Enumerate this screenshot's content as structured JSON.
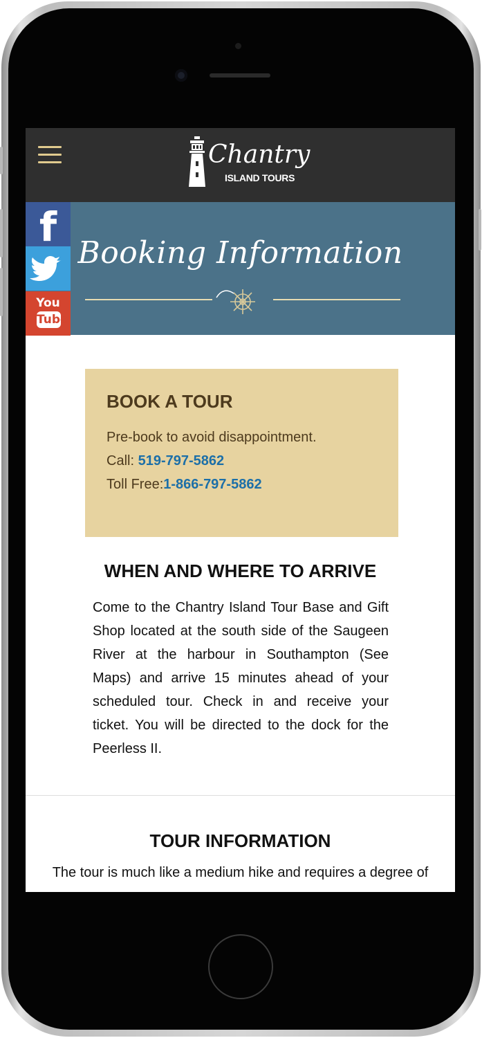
{
  "header": {
    "menu_icon": "hamburger-menu-icon",
    "logo": {
      "script_text": "Chantry",
      "sub_text": "ISLAND TOURS",
      "icon": "lighthouse-icon"
    }
  },
  "banner": {
    "title": "Booking Information",
    "icon": "ship-wheel-icon"
  },
  "social": {
    "facebook": {
      "glyph": "f",
      "icon": "facebook-icon"
    },
    "twitter": {
      "icon": "twitter-bird-icon"
    },
    "youtube": {
      "you": "You",
      "tube": "Tube",
      "icon": "youtube-icon"
    }
  },
  "booking": {
    "heading": "BOOK A TOUR",
    "tagline": "Pre-book to avoid disappointment.",
    "call_label": "Call: ",
    "call_number": "519-797-5862",
    "tollfree_label": "Toll Free:",
    "tollfree_number": "1-866-797-5862"
  },
  "arrive": {
    "heading": "WHEN AND WHERE TO ARRIVE",
    "text": "Come to the Chantry Island Tour Base and Gift Shop located at the south side of the Saugeen River at the harbour in Southampton (See Maps) and arrive 15 minutes ahead of your scheduled tour. Check in and receive your ticket. You will be directed to the dock for the Peerless II."
  },
  "tour": {
    "heading": "TOUR INFORMATION",
    "text": "The tour is much like a medium hike and requires a degree of"
  },
  "colors": {
    "header_bg": "#2f2f2f",
    "banner_bg": "#4b7289",
    "accent_gold": "#e0ca8e",
    "booking_bg": "#e7d3a0",
    "link_blue": "#1c6fa8",
    "facebook": "#3b5998",
    "twitter": "#3ca0dc",
    "youtube": "#d4452f"
  }
}
